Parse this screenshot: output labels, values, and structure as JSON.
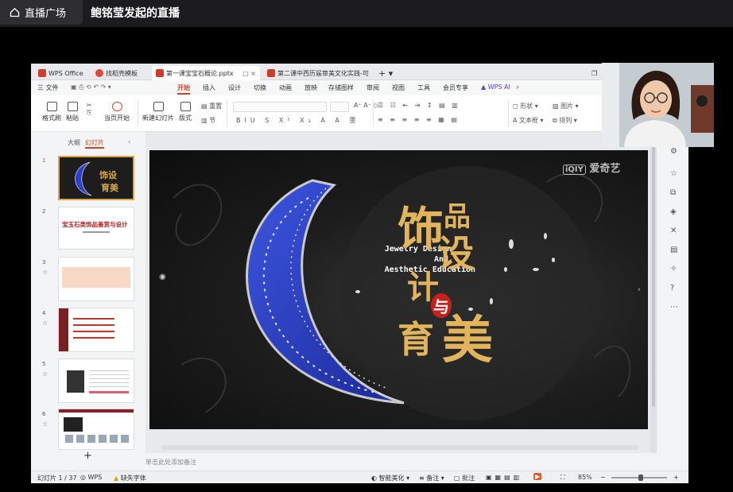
{
  "live": {
    "back_label": "直播广场",
    "title": "鲍铭莹发起的直播"
  },
  "tabs": [
    {
      "label": "WPS Office"
    },
    {
      "label": "找稻壳模板"
    },
    {
      "label": "第一课宝宝石概论.pptx"
    },
    {
      "label": "第二课中西历届审美文化实践-可以听"
    }
  ],
  "menubar": {
    "file": "三 文件",
    "items": [
      "开始",
      "插入",
      "设计",
      "切换",
      "动画",
      "放映",
      "存储图样",
      "审阅",
      "视图",
      "工具",
      "会员专享"
    ],
    "active": "开始",
    "ai": "WPS AI"
  },
  "ribbon": {
    "format_painter": "格式刷",
    "paste": "粘贴",
    "play_current": "当页开始",
    "new_slide": "新建幻灯片",
    "layout": "版式",
    "reset": "重置",
    "section": "节",
    "shape": "形状",
    "picture": "图片",
    "textbox": "文本框",
    "arrange": "排列"
  },
  "left_panel": {
    "tab_outline": "大纲",
    "tab_slides": "幻灯片",
    "add": "+",
    "thumbs": [
      {
        "num": "1"
      },
      {
        "num": "2",
        "title": "宝玉石类饰品鉴赏与设计"
      },
      {
        "num": "3"
      },
      {
        "num": "4"
      },
      {
        "num": "5"
      },
      {
        "num": "6"
      }
    ]
  },
  "slide": {
    "watermark": "爱奇艺",
    "en_line1": "Jewelry Design",
    "en_line2": "And",
    "en_line3": "Aesthetic Education",
    "cn_1": "饰",
    "cn_2": "品",
    "cn_3": "设",
    "cn_4": "计",
    "cn_5": "与",
    "cn_6": "育",
    "cn_7": "美"
  },
  "notes_placeholder": "单击此处添加备注",
  "status": {
    "slide_count": "幻灯片 1 / 37",
    "theme": "WPS",
    "missing_font": "缺失字体",
    "beautify": "智能美化",
    "notes": "备注",
    "comments": "批注",
    "zoom": "85%"
  },
  "colors": {
    "accent": "#d14424",
    "gold": "#d7a64a",
    "royal_blue": "#2238b8"
  }
}
